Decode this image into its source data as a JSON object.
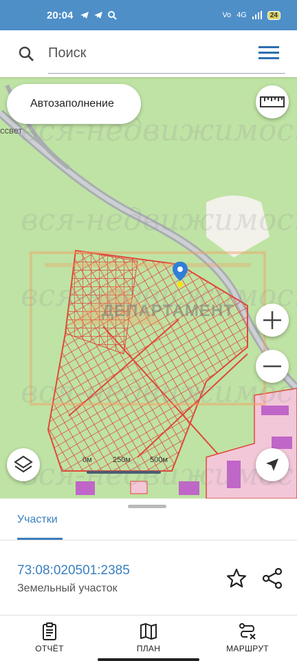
{
  "status_bar": {
    "time": "20:04",
    "network": "4G",
    "battery": "24"
  },
  "search": {
    "placeholder": "Поиск"
  },
  "map": {
    "autofill_label": "Автозаполнение",
    "place_fragment": "ссвет",
    "scale_labels": [
      "0м",
      "250м",
      "500м"
    ],
    "watermark": "вся-недвижимость.пе",
    "overlay_logo_text": "ДЕПАРТАМЕНТ"
  },
  "sheet": {
    "tab_label": "Участки",
    "parcel_number": "73:08:020501:2385",
    "parcel_type": "Земельный участок"
  },
  "nav": {
    "report": "ОТЧЁТ",
    "plan": "ПЛАН",
    "route": "МАРШРУТ"
  },
  "colors": {
    "accent": "#3a7fbf",
    "status_bar": "#4e8fc8",
    "map_green": "#bfe3a4",
    "parcel_red": "#e0483a",
    "road_gray": "#a9adb1"
  },
  "icons": [
    "search-icon",
    "menu-icon",
    "ruler-icon",
    "plus-icon",
    "minus-icon",
    "layers-icon",
    "navigation-arrow-icon",
    "location-pin-icon",
    "star-icon",
    "share-icon",
    "clipboard-icon",
    "map-icon",
    "route-icon"
  ]
}
